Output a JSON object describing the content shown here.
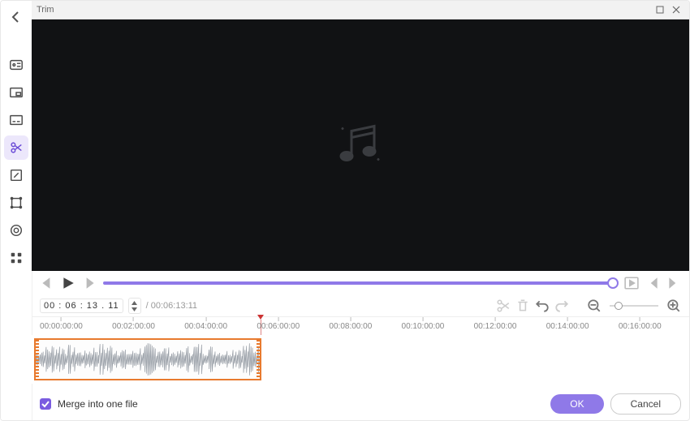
{
  "window": {
    "title": "Trim"
  },
  "sidebar": {
    "active_index": 3,
    "tools": [
      {
        "name": "meta",
        "icon": "meta-icon"
      },
      {
        "name": "watermark",
        "icon": "watermark-icon"
      },
      {
        "name": "add-subtitle",
        "icon": "subtitle-icon"
      },
      {
        "name": "trim",
        "icon": "scissors-icon"
      },
      {
        "name": "resize",
        "icon": "resize-icon"
      },
      {
        "name": "crop",
        "icon": "crop-box-icon"
      },
      {
        "name": "effects",
        "icon": "effects-icon"
      },
      {
        "name": "more-apps",
        "icon": "grid-icon"
      }
    ]
  },
  "timecode": {
    "current": "00 : 06 : 13 . 11",
    "total": "/  00:06:13:11"
  },
  "playback": {
    "progress_pct": 99
  },
  "zoom": {
    "pos_pct": 18
  },
  "ruler": {
    "ticks": [
      "00:00:00:00",
      "00:02:00:00",
      "00:04:00:00",
      "00:06:00:00",
      "00:08:00:00",
      "00:10:00:00",
      "00:12:00:00",
      "00:14:00:00",
      "00:16:00:00"
    ],
    "tick_spacing_pct": 11,
    "tick_start_pct": 4.5,
    "cursor_pct": 34.8
  },
  "clip": {
    "left_pct": 0.4,
    "width_pct": 34.6
  },
  "merge": {
    "checked": true,
    "label": "Merge into one file"
  },
  "buttons": {
    "ok": "OK",
    "cancel": "Cancel"
  },
  "icons": {
    "play_screen": "play-in-screen-icon",
    "prev_frame": "prev-frame-icon",
    "next_frame": "next-frame-icon"
  }
}
